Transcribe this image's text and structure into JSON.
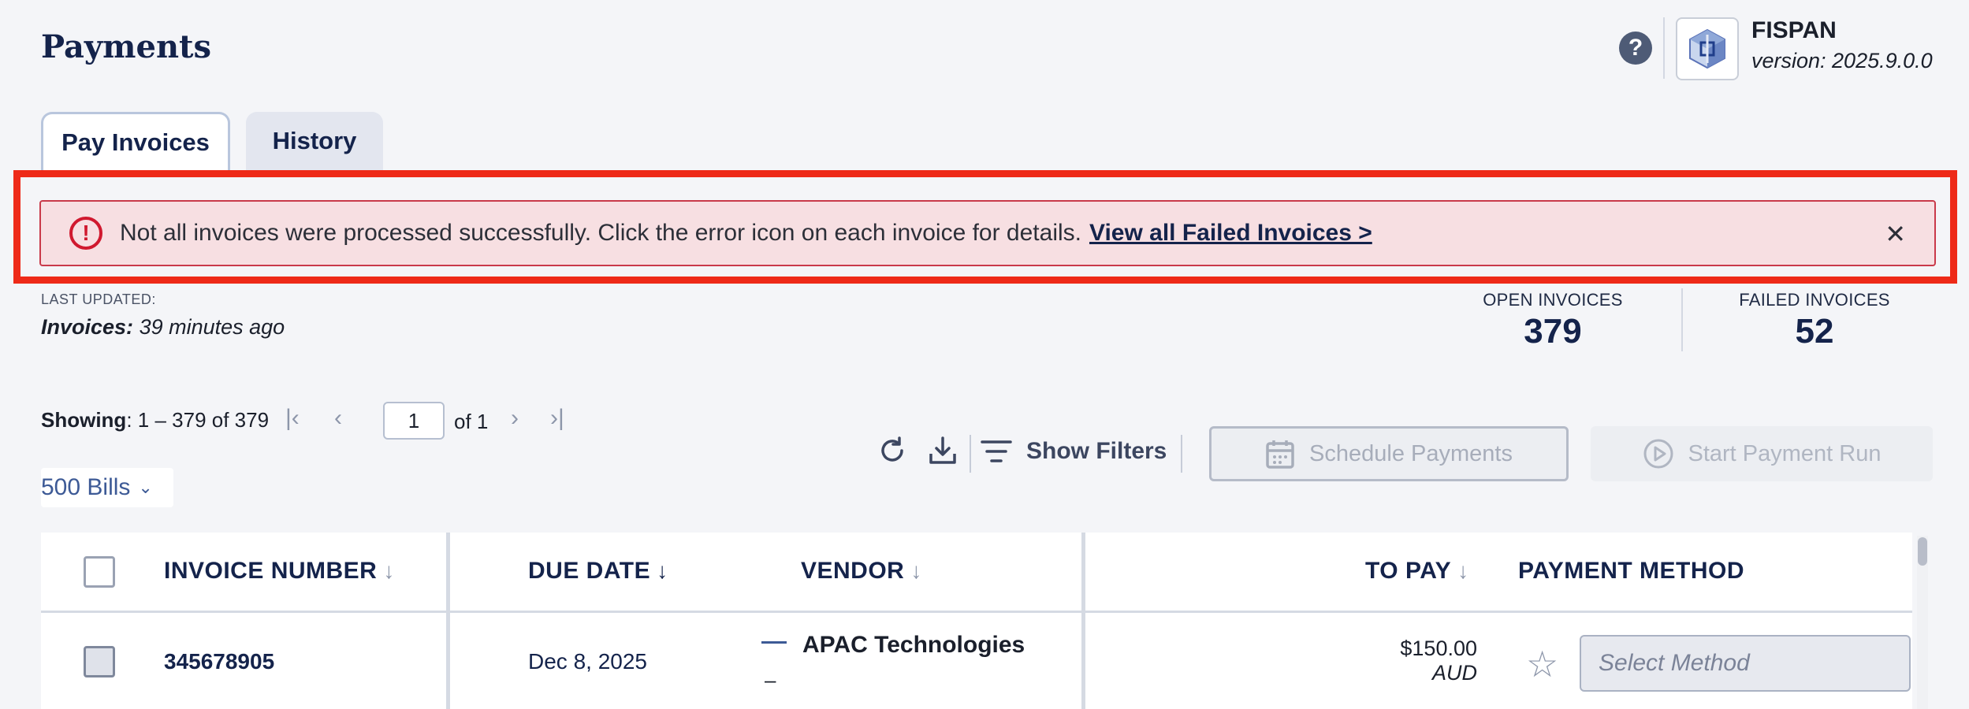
{
  "page": {
    "title": "Payments"
  },
  "header": {
    "help_icon": "question-circle-icon",
    "brand_name": "FISPAN",
    "version": "version: 2025.9.0.0"
  },
  "tabs": [
    {
      "label": "Pay Invoices",
      "active": true
    },
    {
      "label": "History",
      "active": false
    }
  ],
  "alert": {
    "icon": "error-circle-icon",
    "message": "Not all invoices were processed successfully. Click the error icon on each invoice for details.",
    "link_label": "View all Failed Invoices >",
    "close_label": "✕",
    "highlight_color": "#ee2a18"
  },
  "last_updated": {
    "label": "LAST UPDATED:",
    "entity": "Invoices:",
    "value": "39 minutes ago"
  },
  "stats": {
    "open_label": "OPEN INVOICES",
    "open_value": "379",
    "failed_label": "FAILED INVOICES",
    "failed_value": "52"
  },
  "pagination": {
    "showing_label": "Showing",
    "showing_range": ": 1 – 379 of 379",
    "page": "1",
    "of_label": "of 1"
  },
  "bills_select": {
    "value": "500 Bills"
  },
  "toolbar": {
    "show_filters_label": "Show Filters",
    "schedule_label": "Schedule Payments",
    "start_run_label": "Start Payment Run"
  },
  "table": {
    "columns": {
      "invoice_number": "INVOICE NUMBER",
      "due_date": "DUE DATE",
      "vendor": "VENDOR",
      "to_pay": "TO PAY",
      "payment_method": "PAYMENT METHOD"
    },
    "rows": [
      {
        "invoice_number": "345678905",
        "due_date": "Dec 8, 2025",
        "vendor": "APAC Technologies",
        "vendor_sub": "–",
        "amount": "$150.00",
        "currency": "AUD",
        "method_placeholder": "Select Method"
      }
    ]
  },
  "colors": {
    "accent": "#14234b",
    "link": "#3d5a96",
    "alert_bg": "#f7dfe2",
    "alert_border": "#c93a4a"
  }
}
